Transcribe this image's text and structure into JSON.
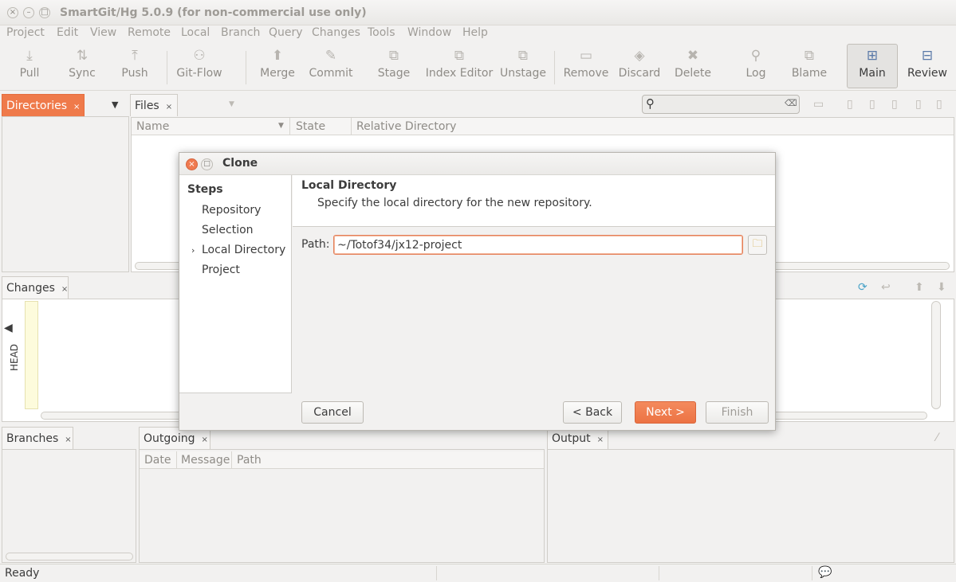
{
  "window": {
    "title": "SmartGit/Hg 5.0.9 (for non-commercial use only)",
    "controls": [
      "close-icon",
      "minimize-icon",
      "maximize-icon"
    ]
  },
  "menu": [
    "Project",
    "Edit",
    "View",
    "Remote",
    "Local",
    "Branch",
    "Query",
    "Changes",
    "Tools",
    "Window",
    "Help"
  ],
  "toolbar": {
    "pull": "Pull",
    "sync": "Sync",
    "push": "Push",
    "gitflow": "Git-Flow",
    "merge": "Merge",
    "commit": "Commit",
    "stage": "Stage",
    "index_editor": "Index Editor",
    "unstage": "Unstage",
    "remove": "Remove",
    "discard": "Discard",
    "delete": "Delete",
    "log": "Log",
    "blame": "Blame",
    "main": "Main",
    "review": "Review"
  },
  "panels": {
    "directories": {
      "tab": "Directories",
      "close": "×"
    },
    "files": {
      "tab": "Files",
      "close": "×",
      "columns": [
        "Name",
        "State",
        "Relative Directory"
      ]
    },
    "changes": {
      "tab": "Changes",
      "close": "×",
      "head_label": "HEAD"
    },
    "branches": {
      "tab": "Branches",
      "close": "×"
    },
    "outgoing": {
      "tab": "Outgoing",
      "close": "×",
      "columns": [
        "Date",
        "Message",
        "Path"
      ]
    },
    "output": {
      "tab": "Output",
      "close": "×"
    }
  },
  "search": {
    "placeholder": ""
  },
  "status": {
    "text": "Ready"
  },
  "dialog": {
    "title": "Clone",
    "steps_title": "Steps",
    "steps": [
      "Repository",
      "Selection",
      "Local Directory",
      "Project"
    ],
    "current_step_marker": "›",
    "header_title": "Local Directory",
    "header_desc": "Specify the local directory for the new repository.",
    "path_label": "Path:",
    "path_value": "~/Totof34/jx12-project",
    "buttons": {
      "cancel": "Cancel",
      "back": "< Back",
      "next": "Next >",
      "finish": "Finish"
    }
  },
  "colors": {
    "accent": "#ef7a4a",
    "background": "#f2f1f0"
  }
}
